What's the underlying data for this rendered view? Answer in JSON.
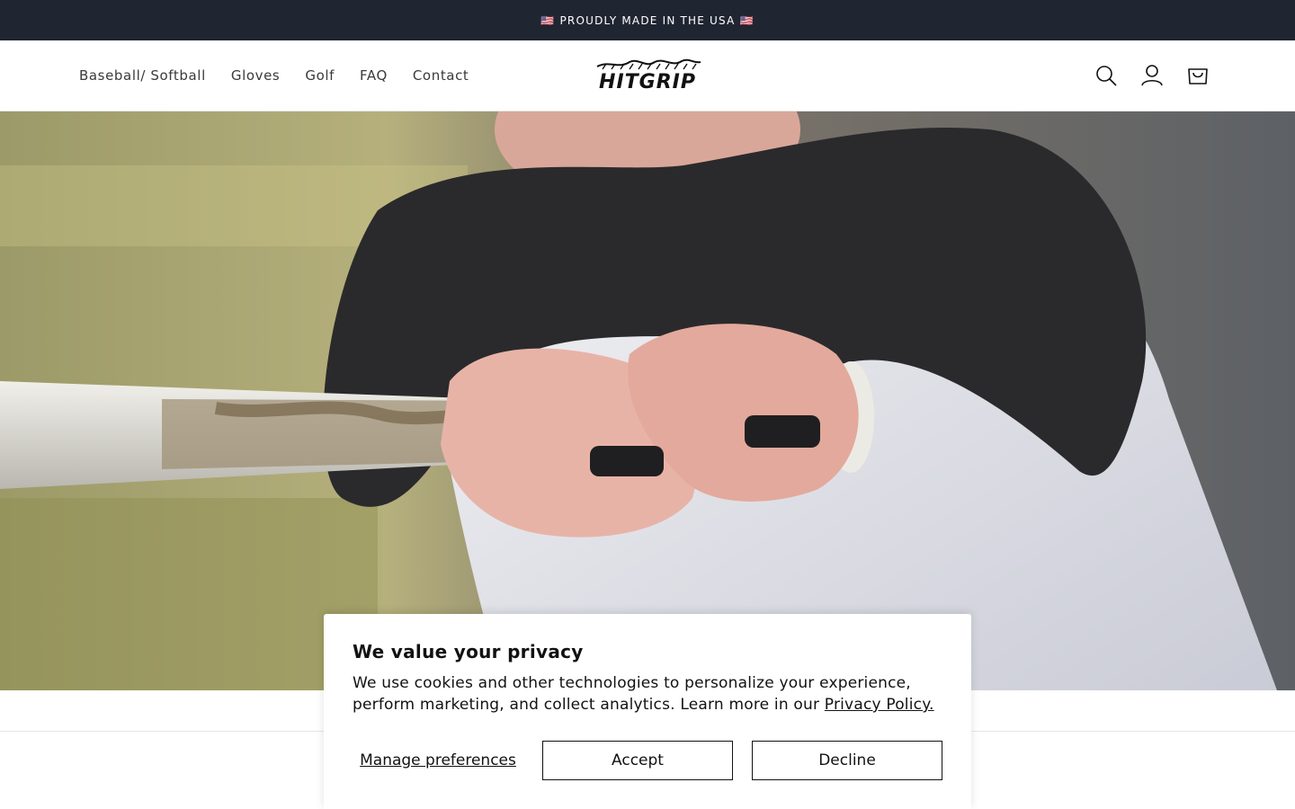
{
  "announcement": {
    "text": "🇺🇸 PROUDLY MADE IN THE USA 🇺🇸"
  },
  "header": {
    "logo_text": "HITGRIP",
    "nav": [
      {
        "label": "Baseball/ Softball"
      },
      {
        "label": "Gloves"
      },
      {
        "label": "Golf"
      },
      {
        "label": "FAQ"
      },
      {
        "label": "Contact"
      }
    ],
    "icons": [
      "search-icon",
      "account-icon",
      "cart-icon"
    ]
  },
  "hero": {
    "image": "player-gripping-bat-with-finger-grips"
  },
  "cookie_banner": {
    "title": "We value your privacy",
    "body": "We use cookies and other technologies to personalize your experience, perform marketing, and collect analytics. Learn more in our",
    "link": "Privacy Policy.",
    "manage_label": "Manage preferences",
    "accept_label": "Accept",
    "decline_label": "Decline"
  },
  "colors": {
    "announcement_bg": "#202532",
    "text": "#121212",
    "border": "#e6e6e6"
  }
}
